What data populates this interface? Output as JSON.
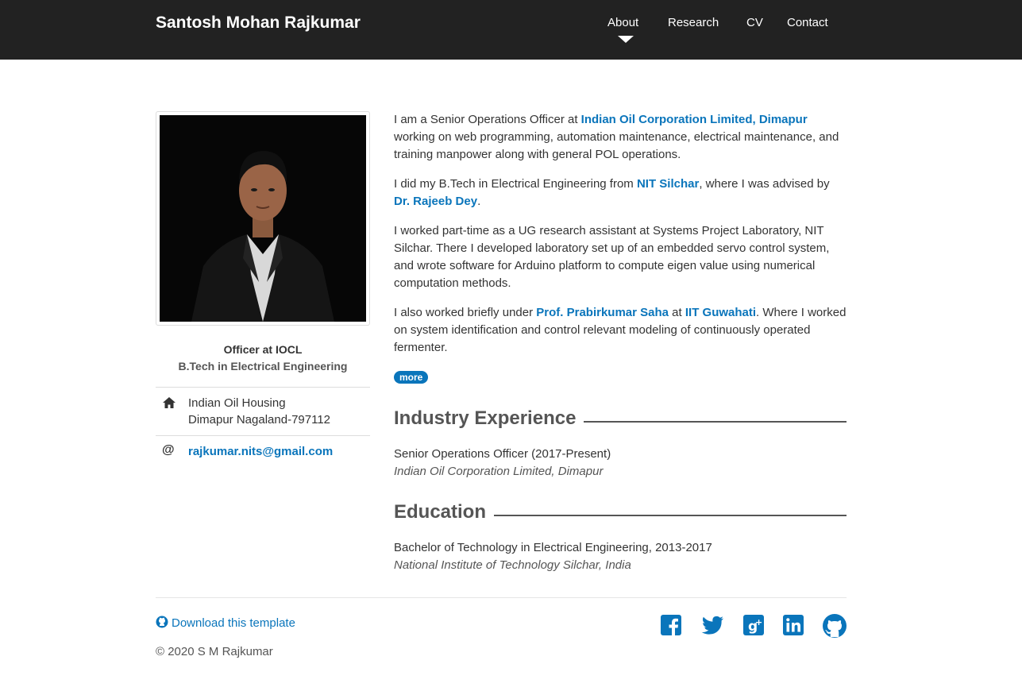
{
  "header": {
    "brand": "Santosh Mohan Rajkumar",
    "nav": [
      "About",
      "Research",
      "CV",
      "Contact"
    ],
    "active": "About"
  },
  "profile": {
    "role": "Officer at IOCL",
    "degree": "B.Tech in Electrical Engineering",
    "address_line1": "Indian Oil Housing",
    "address_line2": "Dimapur Nagaland-797112",
    "email": "rajkumar.nits@gmail.com"
  },
  "bio": {
    "p1_a": "I am a Senior Operations Officer at ",
    "p1_link": "Indian Oil Corporation Limited, Dimapur",
    "p1_b": " working on web programming, automation maintenance, electrical maintenance, and training manpower along with general POL operations.",
    "p2_a": "I did my B.Tech in Electrical Engineering from ",
    "p2_link1": "NIT Silchar",
    "p2_b": ", where I was advised by ",
    "p2_link2": "Dr. Rajeeb Dey",
    "p2_c": ".",
    "p3": "I worked part-time as a UG research assistant at Systems Project Laboratory, NIT Silchar. There I developed laboratory set up of an embedded servo control system, and wrote software for Arduino platform to compute eigen value using numerical computation methods.",
    "p4_a": "I also worked briefly under ",
    "p4_link1": "Prof. Prabirkumar Saha",
    "p4_b": " at ",
    "p4_link2": "IIT Guwahati",
    "p4_c": ". Where I worked on system identification and control relevant modeling of continuously operated fermenter.",
    "more": "more"
  },
  "industry": {
    "heading": "Industry Experience",
    "title": "Senior Operations Officer (2017-Present)",
    "org": "Indian Oil Corporation Limited, Dimapur"
  },
  "education": {
    "heading": "Education",
    "title": "Bachelor of Technology in Electrical Engineering, 2013-2017",
    "org": "National Institute of Technology Silchar, India"
  },
  "footer": {
    "download": "Download this template",
    "copyright": "© 2020 S M Rajkumar",
    "social": [
      "facebook-icon",
      "twitter-icon",
      "google-plus-icon",
      "linkedin-icon",
      "github-icon"
    ]
  },
  "colors": {
    "navbar": "#222222",
    "link": "#0a75bb",
    "heading": "#555555"
  }
}
